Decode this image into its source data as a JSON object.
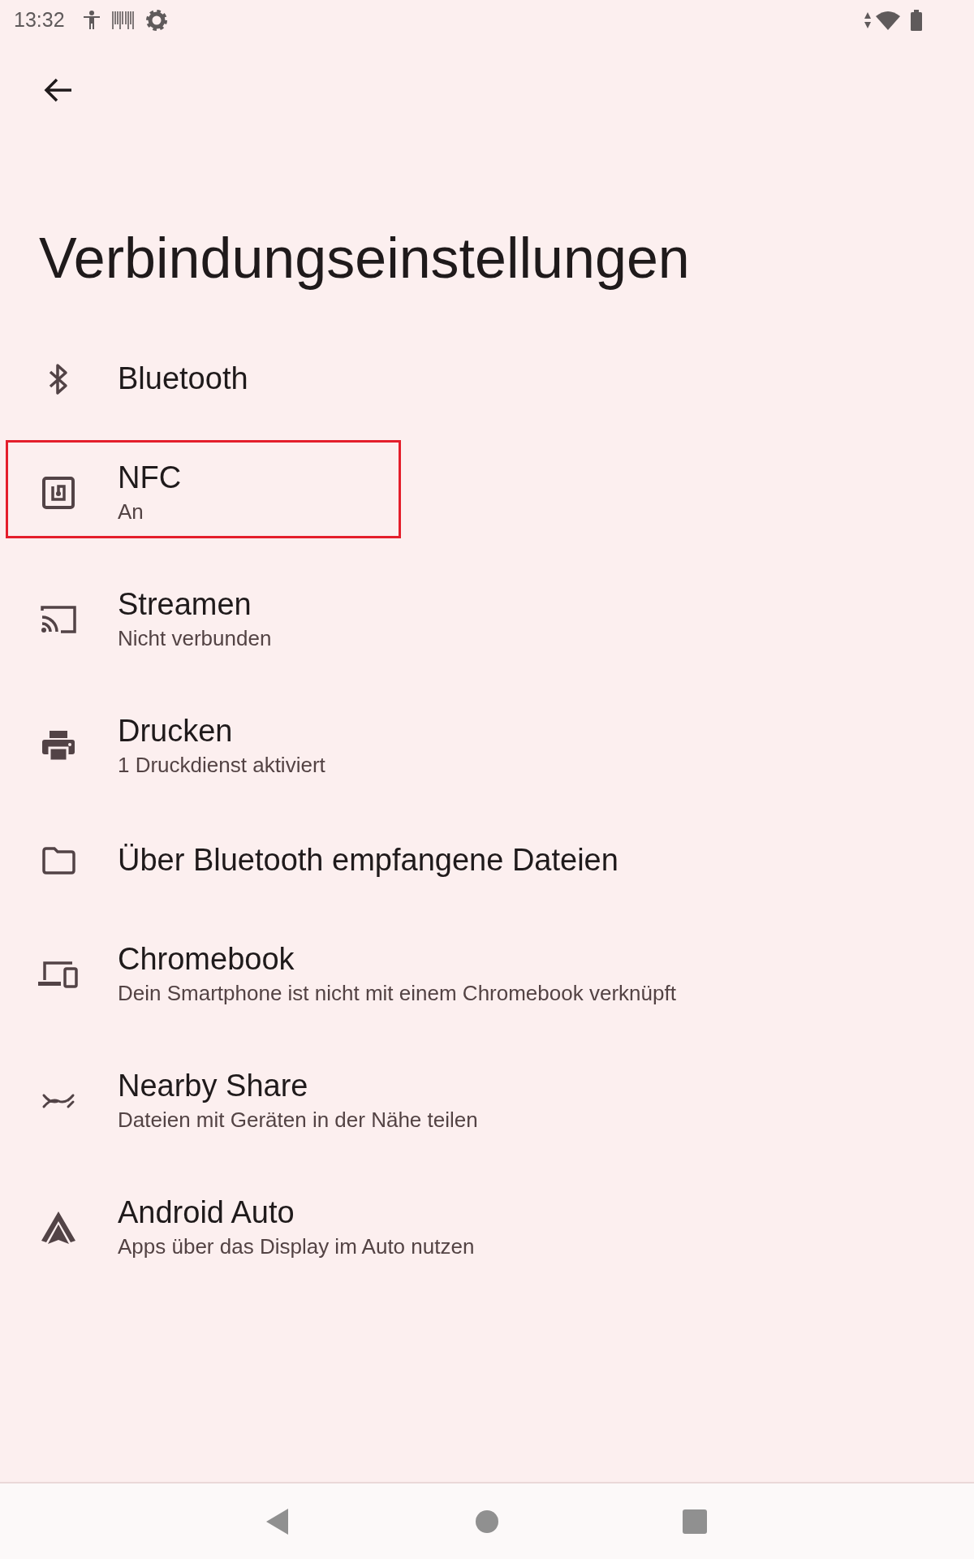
{
  "status_bar": {
    "time": "13:32"
  },
  "title": "Verbindungseinstellungen",
  "items": [
    {
      "title": "Bluetooth",
      "highlighted": false
    },
    {
      "title": "NFC",
      "subtitle": "An",
      "highlighted": true
    },
    {
      "title": "Streamen",
      "subtitle": "Nicht verbunden",
      "highlighted": false
    },
    {
      "title": "Drucken",
      "subtitle": "1 Druckdienst aktiviert",
      "highlighted": false
    },
    {
      "title": "Über Bluetooth empfangene Dateien",
      "highlighted": false
    },
    {
      "title": "Chromebook",
      "subtitle": "Dein Smartphone ist nicht mit einem Chromebook verknüpft",
      "highlighted": false
    },
    {
      "title": "Nearby Share",
      "subtitle": "Dateien mit Geräten in der Nähe teilen",
      "highlighted": false
    },
    {
      "title": "Android Auto",
      "subtitle": "Apps über das Display im Auto nutzen",
      "highlighted": false
    }
  ]
}
